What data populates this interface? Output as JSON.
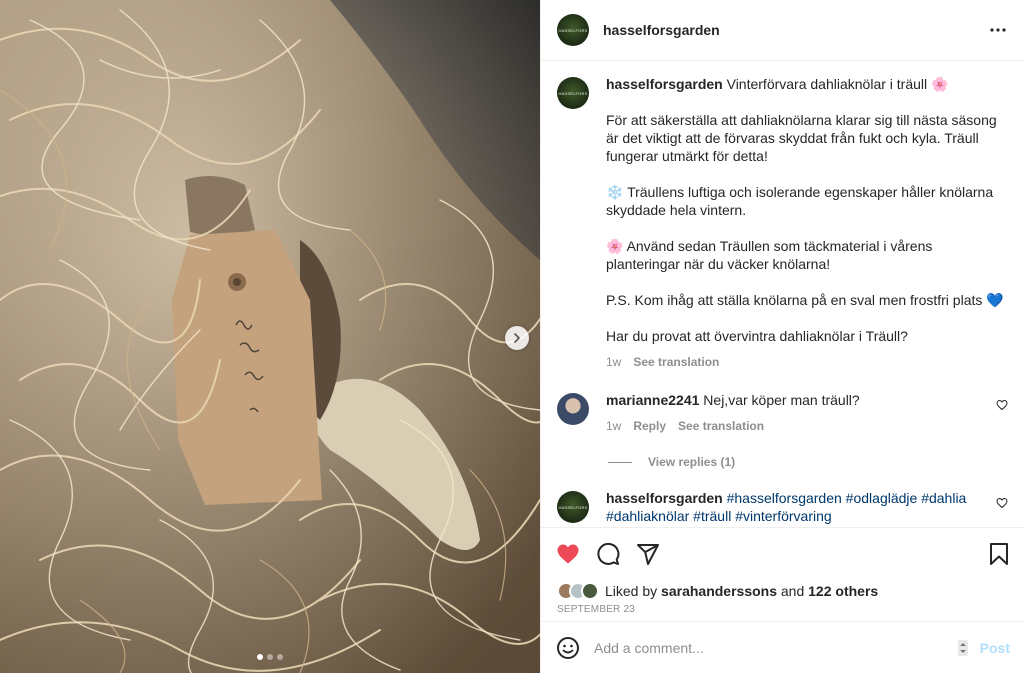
{
  "account": {
    "username": "hasselforsgarden",
    "avatar_text": "HASSELFORS"
  },
  "header": {
    "more_icon": "more-horizontal-icon"
  },
  "caption": {
    "username": "hasselforsgarden",
    "title": "Vinterförvara dahliaknölar i träull",
    "title_emoji": "🌸",
    "p1": "För att säkerställa att dahliaknölarna klarar sig till nästa säsong är det viktigt att de förvaras skyddat från fukt och kyla. Träull fungerar utmärkt för detta!",
    "p2_emoji": "❄️",
    "p2": "Träullens luftiga och isolerande egenskaper håller knölarna skyddade hela vintern.",
    "p3_emoji": "🌸",
    "p3": "Använd sedan Träullen som täckmaterial i vårens planteringar när du väcker knölarna!",
    "p4": "P.S. Kom ihåg att ställa knölarna på en sval men frostfri plats",
    "p4_emoji": "💙",
    "p5": "Har du provat att övervintra dahliaknölar i Träull?",
    "time": "1w",
    "see_translation": "See translation"
  },
  "comments": [
    {
      "username": "marianne2241",
      "text": "Nej,var köper man träull?",
      "time": "1w",
      "reply": "Reply",
      "see_translation": "See translation",
      "view_replies": "View replies (1)"
    },
    {
      "username": "hasselforsgarden",
      "hashtags": "#hasselforsgarden #odlaglädje #dahlia #dahliaknölar #träull #vinterförvaring"
    }
  ],
  "actions": {
    "like_icon": "heart-filled-icon",
    "comment_icon": "comment-icon",
    "share_icon": "send-icon",
    "save_icon": "bookmark-icon",
    "like_color": "#ed4956"
  },
  "likes": {
    "prefix": "Liked by",
    "user": "sarahanderssons",
    "and": "and",
    "others": "122 others"
  },
  "date": "SEPTEMBER 23",
  "add_comment": {
    "placeholder": "Add a comment...",
    "post_label": "Post",
    "emoji_icon": "smiley-icon"
  },
  "media": {
    "slide_count": 3,
    "active_slide": 1,
    "next_icon": "chevron-right-icon"
  }
}
